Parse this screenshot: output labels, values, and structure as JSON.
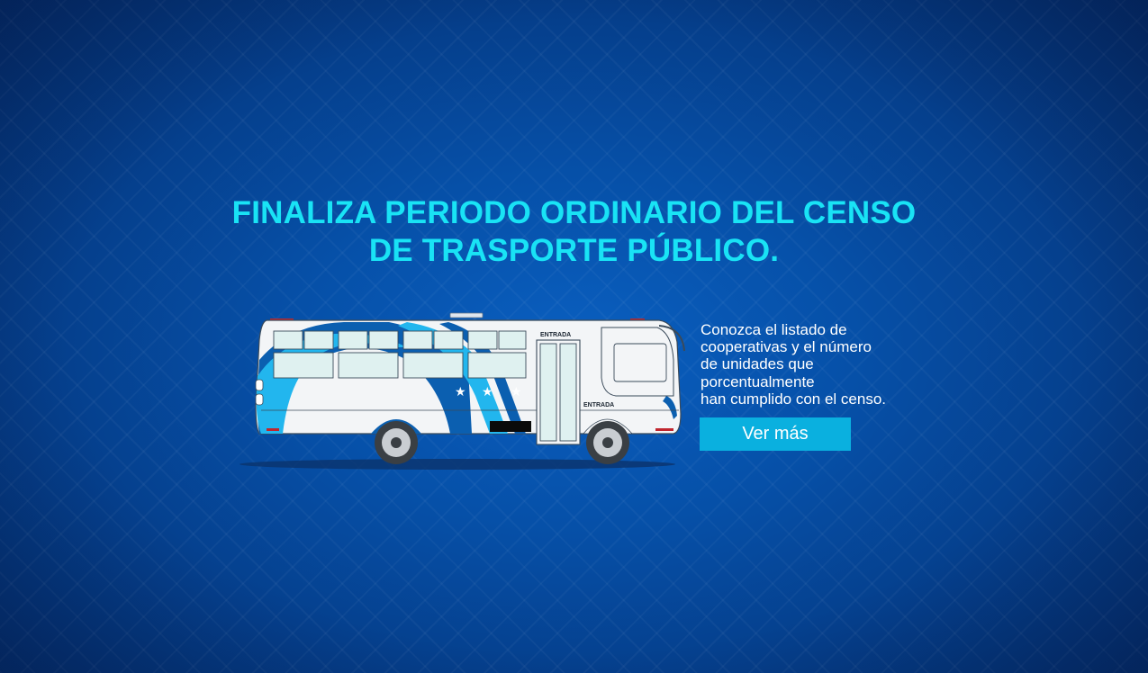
{
  "banner": {
    "headline_line1": "FINALIZA PERIODO ORDINARIO DEL CENSO",
    "headline_line2": "DE TRASPORTE PÚBLICO.",
    "info_lines": [
      "Conozca el listado de",
      "cooperativas y el número",
      "de unidades que",
      "porcentualmente",
      "han cumplido con el censo."
    ],
    "cta_label": "Ver más",
    "bus": {
      "door_label": "ENTRADA",
      "side_label": "ENTRADA"
    }
  },
  "colors": {
    "background": "#0650a8",
    "headline": "#19e3f5",
    "cta": "#0ab0df",
    "bus_accent_light": "#22b6ee",
    "bus_accent_dark": "#0b5fb0"
  }
}
